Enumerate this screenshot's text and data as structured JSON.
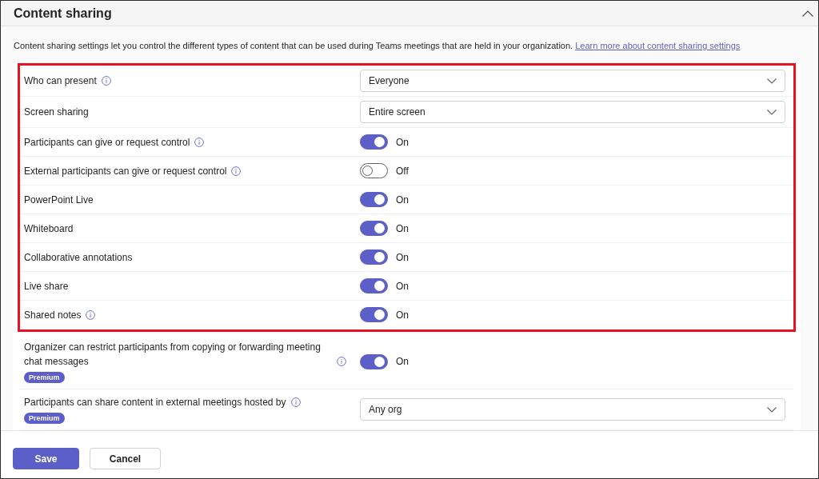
{
  "section": {
    "title": "Content sharing",
    "expanded": true,
    "description": "Content sharing settings let you control the different types of content that can be used during Teams meetings that are held in your organization.",
    "link": "Learn more about content sharing settings"
  },
  "setting_groups": [
    {
      "highlighted": true,
      "settings": [
        {
          "kind": "dropdown",
          "label": "Who can present",
          "info": true,
          "value": "Everyone"
        },
        {
          "kind": "dropdown",
          "label": "Screen sharing",
          "value": "Entire screen"
        },
        {
          "kind": "toggle",
          "label": "Participants can give or request control",
          "info": true,
          "on": true,
          "state_text": "On"
        },
        {
          "kind": "toggle",
          "label": "External participants can give or request control",
          "info": true,
          "on": false,
          "state_text": "Off"
        },
        {
          "kind": "toggle",
          "label": "PowerPoint Live",
          "on": true,
          "state_text": "On"
        },
        {
          "kind": "toggle",
          "label": "Whiteboard",
          "on": true,
          "state_text": "On"
        },
        {
          "kind": "toggle",
          "label": "Collaborative annotations",
          "on": true,
          "state_text": "On"
        },
        {
          "kind": "toggle",
          "label": "Live share",
          "on": true,
          "state_text": "On"
        },
        {
          "kind": "toggle",
          "label": "Shared notes",
          "info": true,
          "on": true,
          "state_text": "On"
        }
      ]
    },
    {
      "settings": [
        {
          "kind": "toggle",
          "label": "Organizer can restrict participants from copying or forwarding meeting chat messages",
          "info": true,
          "badge": "Premium",
          "on": true,
          "state_text": "On"
        },
        {
          "kind": "dropdown",
          "label": "Participants can share content in external meetings hosted by",
          "info": true,
          "badge": "Premium",
          "value": "Any org"
        }
      ]
    }
  ],
  "footer": {
    "buttons": [
      {
        "kind": "primary",
        "label": "Save"
      },
      {
        "kind": "secondary",
        "label": "Cancel"
      }
    ]
  }
}
